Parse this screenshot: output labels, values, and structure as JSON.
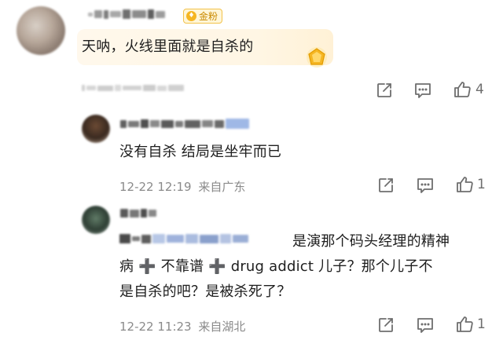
{
  "comments": [
    {
      "text": "天呐，火线里面就是自杀的",
      "badge": "金粉",
      "share_count": "",
      "comment_count": "",
      "like_count": "4"
    },
    {
      "text": "没有自杀 结局是坐牢而已",
      "time": "12-22 12:19",
      "location": "来自广东",
      "like_count": "1"
    },
    {
      "text_line1": "是演那个码头经理的精神",
      "text_line2": "病 ➕ 不靠谱 ➕ drug addict 儿子？那个儿子不",
      "text_line3": "是自杀的吧？是被杀死了？",
      "time": "12-22 11:23",
      "location": "来自湖北",
      "like_count": "1"
    }
  ],
  "colors": {
    "text": "#1e1e1e",
    "meta": "#8a8a8a",
    "icon": "#6e6e6e",
    "badge_border": "#f2c24a",
    "bubble": "#fff6e4"
  },
  "icons": [
    "share-icon",
    "comment-icon",
    "like-icon",
    "gold-gem-icon"
  ]
}
